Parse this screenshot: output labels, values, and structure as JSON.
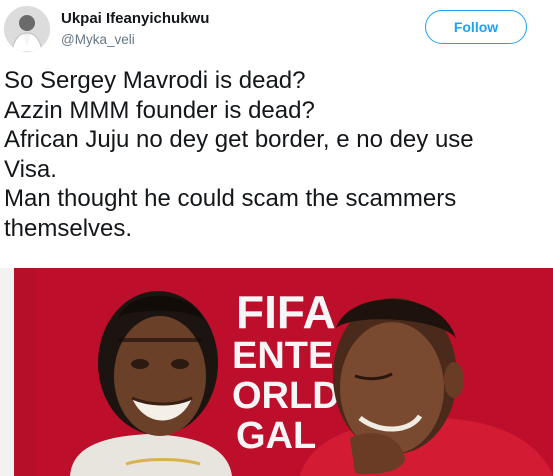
{
  "tweet": {
    "author": {
      "display_name": "Ukpai Ifeanyichukwu",
      "handle": "@Myka_veli"
    },
    "follow_label": "Follow",
    "text_lines": [
      "So Sergey Mavrodi is dead?",
      "Azzin MMM founder is dead?",
      "African Juju no dey get border, e no dey use",
      "Visa.",
      "Man thought he could scam the scammers",
      "themselves."
    ],
    "photo": {
      "backdrop_text": [
        "FIFA",
        "ENTE",
        "ORLD",
        "GAL"
      ]
    }
  },
  "colors": {
    "accent": "#1da1f2",
    "text": "#14171a",
    "secondary_text": "#657786",
    "backdrop_red": "#c8102e"
  }
}
